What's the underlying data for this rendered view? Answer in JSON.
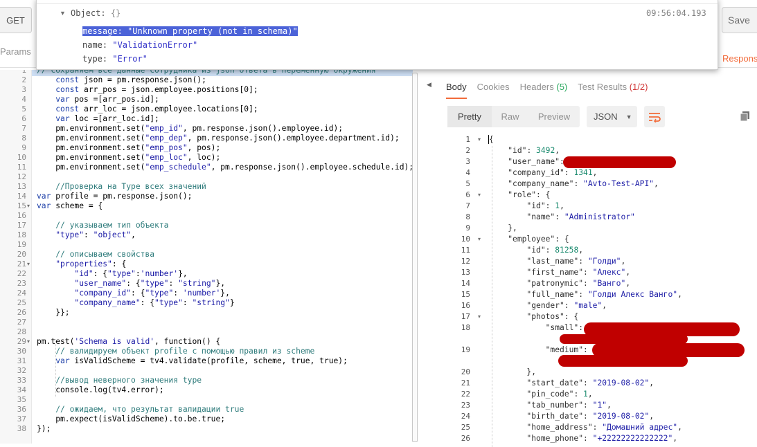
{
  "request": {
    "method": "GET",
    "save_label": "Save",
    "params_tab": "Params",
    "response_tab": "Respons"
  },
  "console": {
    "object_label": "Object:",
    "object_brace": "{}",
    "time": "09:56:04.193",
    "fields": [
      {
        "key": "message:",
        "value": "\"Unknown property (not in schema)\""
      },
      {
        "key": "name:",
        "value": "\"ValidationError\""
      },
      {
        "key": "type:",
        "value": "\"Error\""
      }
    ]
  },
  "editor": {
    "lines": [
      "// сохраняем все данные сотрудника из json ответа в переменную окружения",
      "    const json = pm.response.json();",
      "    const arr_pos = json.employee.positions[0];",
      "    var pos =[arr_pos.id];",
      "    const arr_loc = json.employee.locations[0];",
      "    var loc =[arr_loc.id];",
      "    pm.environment.set(\"emp_id\", pm.response.json().employee.id);",
      "    pm.environment.set(\"emp_dep\", pm.response.json().employee.department.id);",
      "    pm.environment.set(\"emp_pos\", pos);",
      "    pm.environment.set(\"emp_loc\", loc);",
      "    pm.environment.set(\"emp_schedule\", pm.response.json().employee.schedule.id);",
      "",
      "    //Проверка на Type всех значений",
      "var profile = pm.response.json();",
      "var scheme = {",
      "",
      "    // указываем тип объекта",
      "    \"type\": \"object\",",
      "",
      "    // описываем свойства",
      "    \"properties\": {",
      "        \"id\": {\"type\":'number'},",
      "        \"user_name\": {\"type\": \"string\"},",
      "        \"company_id\": {\"type\": 'number'},",
      "        \"company_name\": {\"type\": \"string\"}",
      "    }};",
      "",
      "",
      "pm.test('Schema is valid', function() {",
      "    // валидируем объект profile с помощью правил из scheme",
      "    var isValidScheme = tv4.validate(profile, scheme, true, true);",
      "",
      "    //вывод неверного значения type",
      "    console.log(tv4.error);",
      "",
      "    // ожидаем, что результат валидации true",
      "    pm.expect(isValidScheme).to.be.true;",
      "});"
    ]
  },
  "response": {
    "tabs": [
      {
        "label": "Body",
        "count": ""
      },
      {
        "label": "Cookies",
        "count": ""
      },
      {
        "label": "Headers",
        "count": "(5)"
      },
      {
        "label": "Test Results",
        "count": "(1/2)"
      }
    ],
    "views": [
      "Pretty",
      "Raw",
      "Preview"
    ],
    "format": "JSON",
    "json_lines": [
      {
        "n": "1",
        "t": "{"
      },
      {
        "n": "2",
        "t": "    \"id\": 3492,"
      },
      {
        "n": "3",
        "t": "    \"user_name\":"
      },
      {
        "n": "4",
        "t": "    \"company_id\": 1341,"
      },
      {
        "n": "5",
        "t": "    \"company_name\": \"Avto-Test-API\","
      },
      {
        "n": "6",
        "t": "    \"role\": {"
      },
      {
        "n": "7",
        "t": "        \"id\": 1,"
      },
      {
        "n": "8",
        "t": "        \"name\": \"Administrator\""
      },
      {
        "n": "9",
        "t": "    },"
      },
      {
        "n": "10",
        "t": "    \"employee\": {"
      },
      {
        "n": "11",
        "t": "        \"id\": 81258,"
      },
      {
        "n": "12",
        "t": "        \"last_name\": \"Голди\","
      },
      {
        "n": "13",
        "t": "        \"first_name\": \"Алекс\","
      },
      {
        "n": "14",
        "t": "        \"patronymic\": \"Ванго\","
      },
      {
        "n": "15",
        "t": "        \"full_name\": \"Голди Алекс Ванго\","
      },
      {
        "n": "16",
        "t": "        \"gender\": \"male\","
      },
      {
        "n": "17",
        "t": "        \"photos\": {"
      },
      {
        "n": "18",
        "t": "            \"small\":"
      },
      {
        "n": "19",
        "t": "            \"medium\":"
      },
      {
        "n": "20",
        "t": "        },"
      },
      {
        "n": "21",
        "t": "        \"start_date\": \"2019-08-02\","
      },
      {
        "n": "22",
        "t": "        \"pin_code\": 1,"
      },
      {
        "n": "23",
        "t": "        \"tab_number\": \"1\","
      },
      {
        "n": "24",
        "t": "        \"birth_date\": \"2019-08-02\","
      },
      {
        "n": "25",
        "t": "        \"home_address\": \"Домашний адрес\","
      },
      {
        "n": "26",
        "t": "        \"home_phone\": \"+22222222222222\","
      }
    ]
  }
}
